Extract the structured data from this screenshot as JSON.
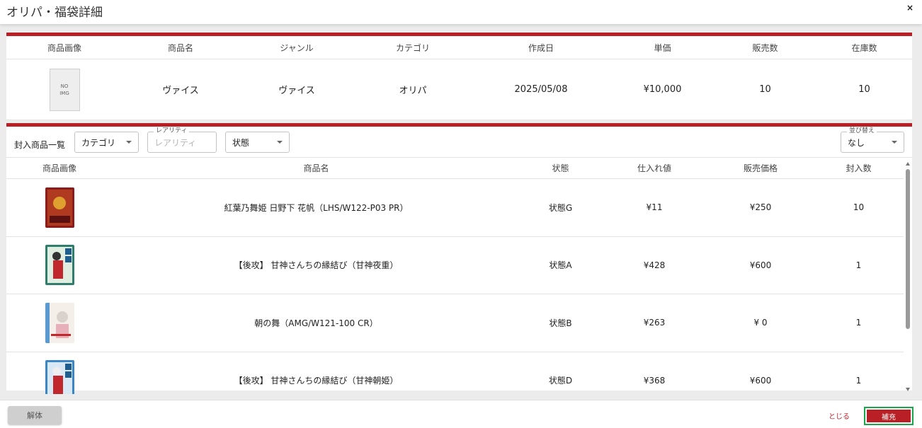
{
  "window": {
    "title": "オリパ・福袋詳細",
    "close_symbol": "×"
  },
  "product_table": {
    "headers": [
      "商品画像",
      "商品名",
      "ジャンル",
      "カテゴリ",
      "作成日",
      "単価",
      "販売数",
      "在庫数"
    ],
    "row": {
      "image_text": [
        "NO",
        "IMG"
      ],
      "name": "ヴァイス",
      "genre": "ヴァイス",
      "category": "オリパ",
      "created": "2025/05/08",
      "unit_price": "¥10,000",
      "sold": "10",
      "stock": "10"
    }
  },
  "filters": {
    "label": "封入商品一覧",
    "category": "カテゴリ",
    "rarity_label": "レアリティ",
    "rarity_placeholder": "レアリティ",
    "condition": "状態",
    "sort_label": "並び替え",
    "sort_value": "なし"
  },
  "items_table": {
    "headers": [
      "商品画像",
      "商品名",
      "状態",
      "仕入れ値",
      "販売価格",
      "封入数"
    ],
    "rows": [
      {
        "name": "紅葉乃舞姫 日野下 花帆（LHS/W122-P03 PR）",
        "condition": "状態G",
        "cost": "¥11",
        "price": "¥250",
        "qty": "10",
        "thumb_color": "#8a1c1c",
        "thumb_accent": "#e0a030"
      },
      {
        "name": "【後攻】 甘神さんちの縁結び（甘神夜重）",
        "condition": "状態A",
        "cost": "¥428",
        "price": "¥600",
        "qty": "1",
        "thumb_color": "#2f7d6a",
        "thumb_accent": "#c0282d"
      },
      {
        "name": "朝の舞（AMG/W121-100 CR）",
        "condition": "状態B",
        "cost": "¥263",
        "price": "¥ 0",
        "qty": "1",
        "thumb_color": "#5b9ad0",
        "thumb_accent": "#f2e8e0"
      },
      {
        "name": "【後攻】 甘神さんちの縁結び（甘神朝姫）",
        "condition": "状態D",
        "cost": "¥368",
        "price": "¥600",
        "qty": "1",
        "thumb_color": "#3b86c4",
        "thumb_accent": "#c0282d"
      }
    ]
  },
  "footer": {
    "dismantle": "解体",
    "close": "とじる",
    "replenish": "補充"
  },
  "colors": {
    "accent_red": "#b82025",
    "focus_green": "#1aa64a"
  }
}
